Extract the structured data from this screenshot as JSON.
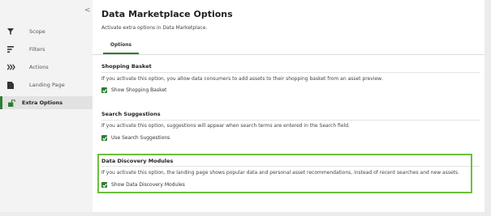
{
  "sidebar": {
    "collapse_glyph": "<",
    "items": [
      {
        "label": "Scope",
        "icon": "funnel-icon"
      },
      {
        "label": "Filters",
        "icon": "filter-lines-icon"
      },
      {
        "label": "Actions",
        "icon": "chevrons-right-icon"
      },
      {
        "label": "Landing Page",
        "icon": "document-icon"
      },
      {
        "label": "Extra Options",
        "icon": "unlock-icon",
        "active": true
      }
    ]
  },
  "main": {
    "title": "Data Marketplace Options",
    "subtitle": "Activate extra options in Data Marketplace.",
    "tabs": [
      {
        "label": "Options",
        "active": true
      }
    ],
    "sections": [
      {
        "title": "Shopping Basket",
        "description": "If you activate this option, you allow data consumers to add assets to their shopping basket from an asset preview.",
        "checkbox_label": "Show Shopping Basket",
        "checked": true
      },
      {
        "title": "Search Suggestions",
        "description": "If you activate this option, suggestions will appear when search terms are entered in the Search field.",
        "checkbox_label": "Use Search Suggestions",
        "checked": true
      },
      {
        "title": "Data Discovery Modules",
        "description": "If you activate this option, the landing page shows popular data and personal asset recommendations, instead of recent searches and new assets.",
        "checkbox_label": "Show Data Discovery Modules",
        "checked": true,
        "highlighted": true
      }
    ]
  },
  "colors": {
    "accent": "#2e7d32",
    "highlight_border": "#6cbf3c"
  }
}
